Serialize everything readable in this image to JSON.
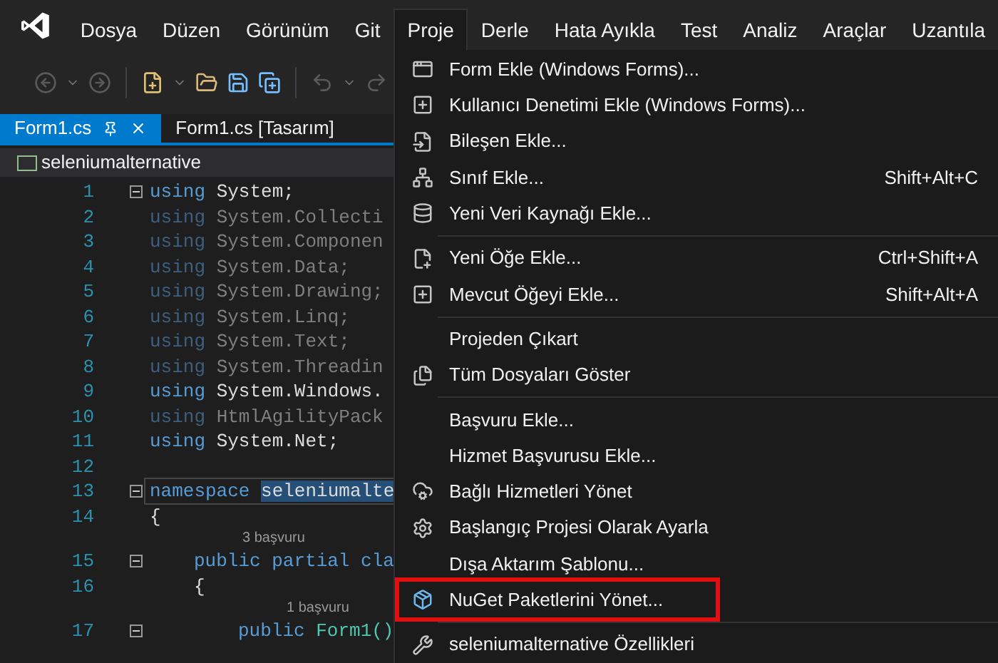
{
  "menu_bar": [
    {
      "label": "Dosya",
      "selected": false
    },
    {
      "label": "Düzen",
      "selected": false
    },
    {
      "label": "Görünüm",
      "selected": false
    },
    {
      "label": "Git",
      "selected": false
    },
    {
      "label": "Proje",
      "selected": true
    },
    {
      "label": "Derle",
      "selected": false
    },
    {
      "label": "Hata Ayıkla",
      "selected": false
    },
    {
      "label": "Test",
      "selected": false
    },
    {
      "label": "Analiz",
      "selected": false
    },
    {
      "label": "Araçlar",
      "selected": false
    },
    {
      "label": "Uzantıla",
      "selected": false
    }
  ],
  "toolbar": [
    {
      "disabled": true
    },
    {
      "disabled": true
    },
    {
      "disabled": false
    },
    {
      "disabled": false
    },
    {
      "disabled": false
    },
    {
      "disabled": false
    },
    {
      "disabled": true
    },
    {
      "disabled": true
    }
  ],
  "tabs": [
    {
      "label": "Form1.cs",
      "selected": true
    },
    {
      "label": "Form1.cs [Tasarım]",
      "selected": false
    }
  ],
  "navigation_bar": {
    "project": "seleniumalternative"
  },
  "editor": {
    "lines": [
      {
        "kind": "code",
        "number": "1",
        "foldable": true,
        "current": false,
        "tokens": [
          {
            "text": "using",
            "kind": "keyword"
          },
          {
            "text": "System;",
            "kind": "plain"
          }
        ]
      },
      {
        "kind": "code",
        "number": "2",
        "foldable": false,
        "current": false,
        "tokens": [
          {
            "text": "using",
            "kind": "keyword_dim"
          },
          {
            "text": "System.Collecti",
            "kind": "plain_dim"
          }
        ]
      },
      {
        "kind": "code",
        "number": "3",
        "foldable": false,
        "current": false,
        "tokens": [
          {
            "text": "using",
            "kind": "keyword_dim"
          },
          {
            "text": "System.Componen",
            "kind": "plain_dim"
          }
        ]
      },
      {
        "kind": "code",
        "number": "4",
        "foldable": false,
        "current": false,
        "tokens": [
          {
            "text": "using",
            "kind": "keyword_dim"
          },
          {
            "text": "System.Data;",
            "kind": "plain_dim"
          }
        ]
      },
      {
        "kind": "code",
        "number": "5",
        "foldable": false,
        "current": false,
        "tokens": [
          {
            "text": "using",
            "kind": "keyword_dim"
          },
          {
            "text": "System.Drawing;",
            "kind": "plain_dim"
          }
        ]
      },
      {
        "kind": "code",
        "number": "6",
        "foldable": false,
        "current": false,
        "tokens": [
          {
            "text": "using",
            "kind": "keyword_dim"
          },
          {
            "text": "System.Linq;",
            "kind": "plain_dim"
          }
        ]
      },
      {
        "kind": "code",
        "number": "7",
        "foldable": false,
        "current": false,
        "tokens": [
          {
            "text": "using",
            "kind": "keyword_dim"
          },
          {
            "text": "System.Text;",
            "kind": "plain_dim"
          }
        ]
      },
      {
        "kind": "code",
        "number": "8",
        "foldable": false,
        "current": false,
        "tokens": [
          {
            "text": "using",
            "kind": "keyword_dim"
          },
          {
            "text": "System.Threadin",
            "kind": "plain_dim"
          }
        ]
      },
      {
        "kind": "code",
        "number": "9",
        "foldable": false,
        "current": false,
        "tokens": [
          {
            "text": "using",
            "kind": "keyword"
          },
          {
            "text": "System.Windows.",
            "kind": "plain"
          }
        ]
      },
      {
        "kind": "code",
        "number": "10",
        "foldable": false,
        "current": false,
        "tokens": [
          {
            "text": "using",
            "kind": "keyword_dim"
          },
          {
            "text": "HtmlAgilityPack",
            "kind": "plain_dim"
          }
        ]
      },
      {
        "kind": "code",
        "number": "11",
        "foldable": false,
        "current": false,
        "tokens": [
          {
            "text": "using",
            "kind": "keyword"
          },
          {
            "text": "System.Net;",
            "kind": "plain"
          }
        ]
      },
      {
        "kind": "code",
        "number": "12",
        "foldable": false,
        "current": false
      },
      {
        "kind": "code",
        "number": "13",
        "foldable": true,
        "current": true,
        "tokens": [
          {
            "text": "namespace",
            "kind": "keyword"
          },
          {
            "text": "seleniumalte",
            "kind": "selection"
          }
        ]
      },
      {
        "kind": "code",
        "number": "14",
        "foldable": false,
        "current": false,
        "tokens": [
          {
            "text": "{",
            "kind": "plain"
          }
        ],
        "children": [
          {
            "kind": "codelens",
            "text": "3 başvuru"
          },
          {
            "kind": "code",
            "number": "15",
            "foldable": true,
            "current": false,
            "tokens": [
              {
                "text": "public",
                "kind": "keyword"
              },
              {
                "text": "partial",
                "kind": "keyword"
              },
              {
                "text": "cla",
                "kind": "keyword"
              }
            ]
          },
          {
            "kind": "code",
            "number": "16",
            "foldable": false,
            "current": false,
            "tokens": [
              {
                "text": "{",
                "kind": "plain"
              }
            ],
            "children": [
              {
                "kind": "codelens",
                "text": "1 başvuru"
              },
              {
                "kind": "code",
                "number": "17",
                "foldable": true,
                "current": false,
                "tokens": [
                  {
                    "text": "public",
                    "kind": "keyword"
                  },
                  {
                    "text": "Form1()",
                    "kind": "type"
                  }
                ]
              }
            ]
          }
        ]
      }
    ]
  },
  "project_menu": [
    {
      "kind": "item",
      "label": "Form Ekle (Windows Forms)...",
      "annotation_box": false
    },
    {
      "kind": "item",
      "label": "Kullanıcı Denetimi Ekle (Windows Forms)...",
      "annotation_box": false
    },
    {
      "kind": "item",
      "label": "Bileşen Ekle...",
      "annotation_box": false
    },
    {
      "kind": "item",
      "label": "Sınıf Ekle...",
      "shortcut": "Shift+Alt+C",
      "annotation_box": false
    },
    {
      "kind": "item",
      "label": "Yeni Veri Kaynağı Ekle...",
      "annotation_box": false
    },
    {
      "kind": "separator"
    },
    {
      "kind": "item",
      "label": "Yeni Öğe Ekle...",
      "shortcut": "Ctrl+Shift+A",
      "annotation_box": false
    },
    {
      "kind": "item",
      "label": "Mevcut Öğeyi Ekle...",
      "shortcut": "Shift+Alt+A",
      "annotation_box": false
    },
    {
      "kind": "separator"
    },
    {
      "kind": "item",
      "label": "Projeden Çıkart",
      "annotation_box": false
    },
    {
      "kind": "item",
      "label": "Tüm Dosyaları Göster",
      "annotation_box": false
    },
    {
      "kind": "separator"
    },
    {
      "kind": "item",
      "label": "Başvuru Ekle...",
      "annotation_box": false
    },
    {
      "kind": "item",
      "label": "Hizmet Başvurusu Ekle...",
      "annotation_box": false
    },
    {
      "kind": "item",
      "label": "Bağlı Hizmetleri Yönet",
      "annotation_box": false
    },
    {
      "kind": "item",
      "label": "Başlangıç Projesi Olarak Ayarla",
      "annotation_box": false
    },
    {
      "kind": "item",
      "label": "Dışa Aktarım Şablonu...",
      "annotation_box": false
    },
    {
      "kind": "item",
      "label": "NuGet Paketlerini Yönet...",
      "annotation_box": true
    },
    {
      "kind": "separator"
    },
    {
      "kind": "item",
      "label": "seleniumalternative Özellikleri",
      "annotation_box": false
    }
  ]
}
